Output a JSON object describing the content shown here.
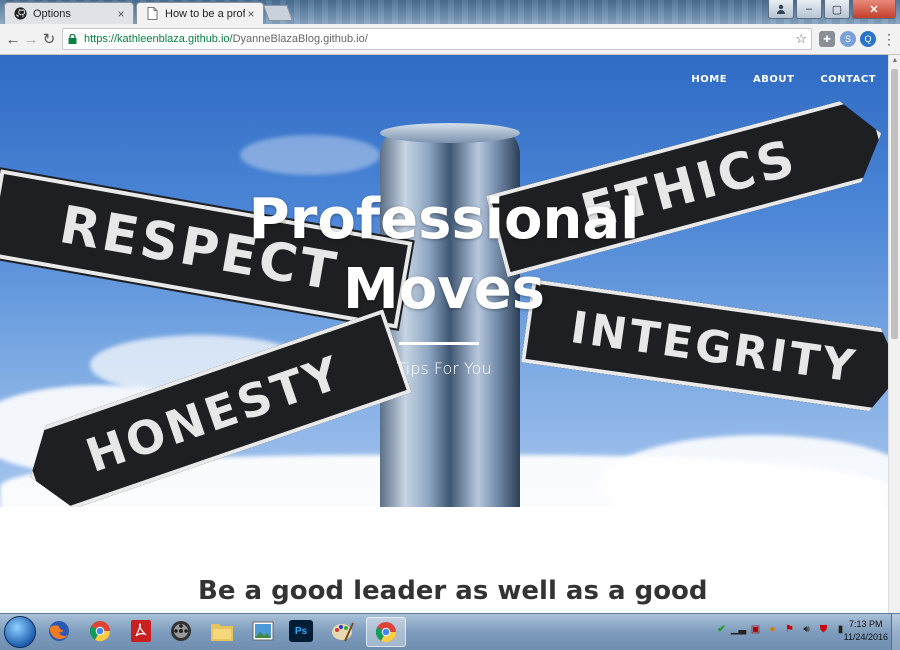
{
  "browser": {
    "tabs": [
      {
        "title": "Options",
        "icon": "github-icon"
      },
      {
        "title": "How to be a professional",
        "icon": "page-icon"
      }
    ],
    "address": {
      "host": "https://kathleenblaza.github.io/",
      "path": "DyanneBlazaBlog.github.io/"
    }
  },
  "site": {
    "nav": [
      "HOME",
      "ABOUT",
      "CONTACT"
    ],
    "hero": {
      "title_line1": "Professional",
      "title_line2": "Moves",
      "subtitle": "Tips For You",
      "signs": [
        "RESPECT",
        "ETHICS",
        "INTEGRITY",
        "HONESTY"
      ]
    },
    "post_title": "Be a good leader as well as a good"
  },
  "taskbar": {
    "clock_time": "7:13 PM",
    "clock_date": "11/24/2016",
    "apps": [
      "firefox-icon",
      "chrome-icon",
      "acrobat-icon",
      "media-icon",
      "explorer-icon",
      "photos-icon",
      "photoshop-icon",
      "paint-icon",
      "chrome-active-icon"
    ]
  },
  "colors": {
    "secure_green": "#0b8043",
    "hero_sky": "#4c86d6",
    "sign": "#1e1f22"
  }
}
